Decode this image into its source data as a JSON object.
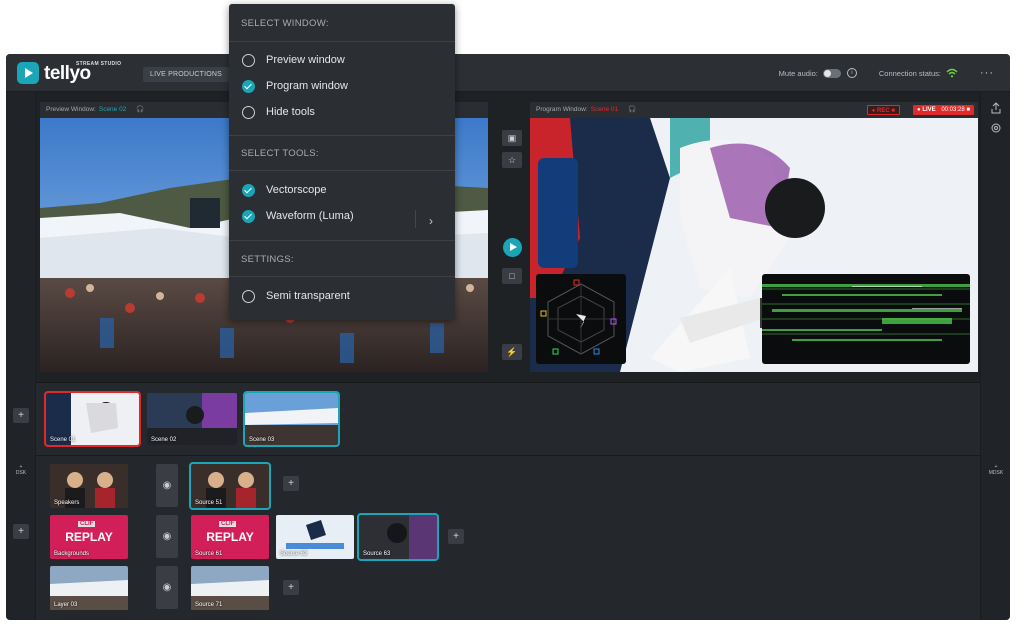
{
  "app": {
    "logo_text": "tellyo",
    "logo_sub": "STREAM STUDIO",
    "nav_button": "LIVE PRODUCTIONS"
  },
  "header": {
    "mute_audio_label": "Mute audio:",
    "connection_status_label": "Connection status:",
    "more_icon": "ellipsis-icon"
  },
  "preview": {
    "label": "Preview Window:",
    "scene": "Scene 02"
  },
  "program": {
    "label": "Program Window:",
    "scene": "Scene 01",
    "rec_label": "REC",
    "live_label": "LIVE",
    "live_time": "00:03:28"
  },
  "scenes": [
    {
      "label": "Scene 01",
      "state": "program"
    },
    {
      "label": "Scene 02",
      "state": "idle"
    },
    {
      "label": "Scene 03",
      "state": "preview"
    }
  ],
  "layers": [
    {
      "label": "Speakers"
    },
    {
      "label": "Backgrounds"
    },
    {
      "label": "Layer 03"
    }
  ],
  "sources": {
    "row1": [
      {
        "label": "Source 51"
      }
    ],
    "row2": [
      {
        "label": "Source 61"
      },
      {
        "label": "Source 62"
      },
      {
        "label": "Source 63"
      }
    ],
    "row3": [
      {
        "label": "Source 71"
      }
    ]
  },
  "side_labels": {
    "dsk": "DSK",
    "mdsk": "MDSK"
  },
  "replay_text": "REPLAY",
  "clif_text": "CLIF",
  "dropdown": {
    "select_window_header": "SELECT WINDOW:",
    "window_options": [
      {
        "label": "Preview window",
        "checked": false
      },
      {
        "label": "Program window",
        "checked": true
      },
      {
        "label": "Hide tools",
        "checked": false
      }
    ],
    "select_tools_header": "SELECT TOOLS:",
    "tool_options": [
      {
        "label": "Vectorscope",
        "checked": true
      },
      {
        "label": "Waveform (Luma)",
        "checked": true
      }
    ],
    "settings_header": "SETTINGS:",
    "settings_options": [
      {
        "label": "Semi transparent",
        "checked": false
      }
    ]
  },
  "colors": {
    "accent": "#1aa6b7",
    "live_red": "#e02a2a",
    "background": "#24272b"
  }
}
